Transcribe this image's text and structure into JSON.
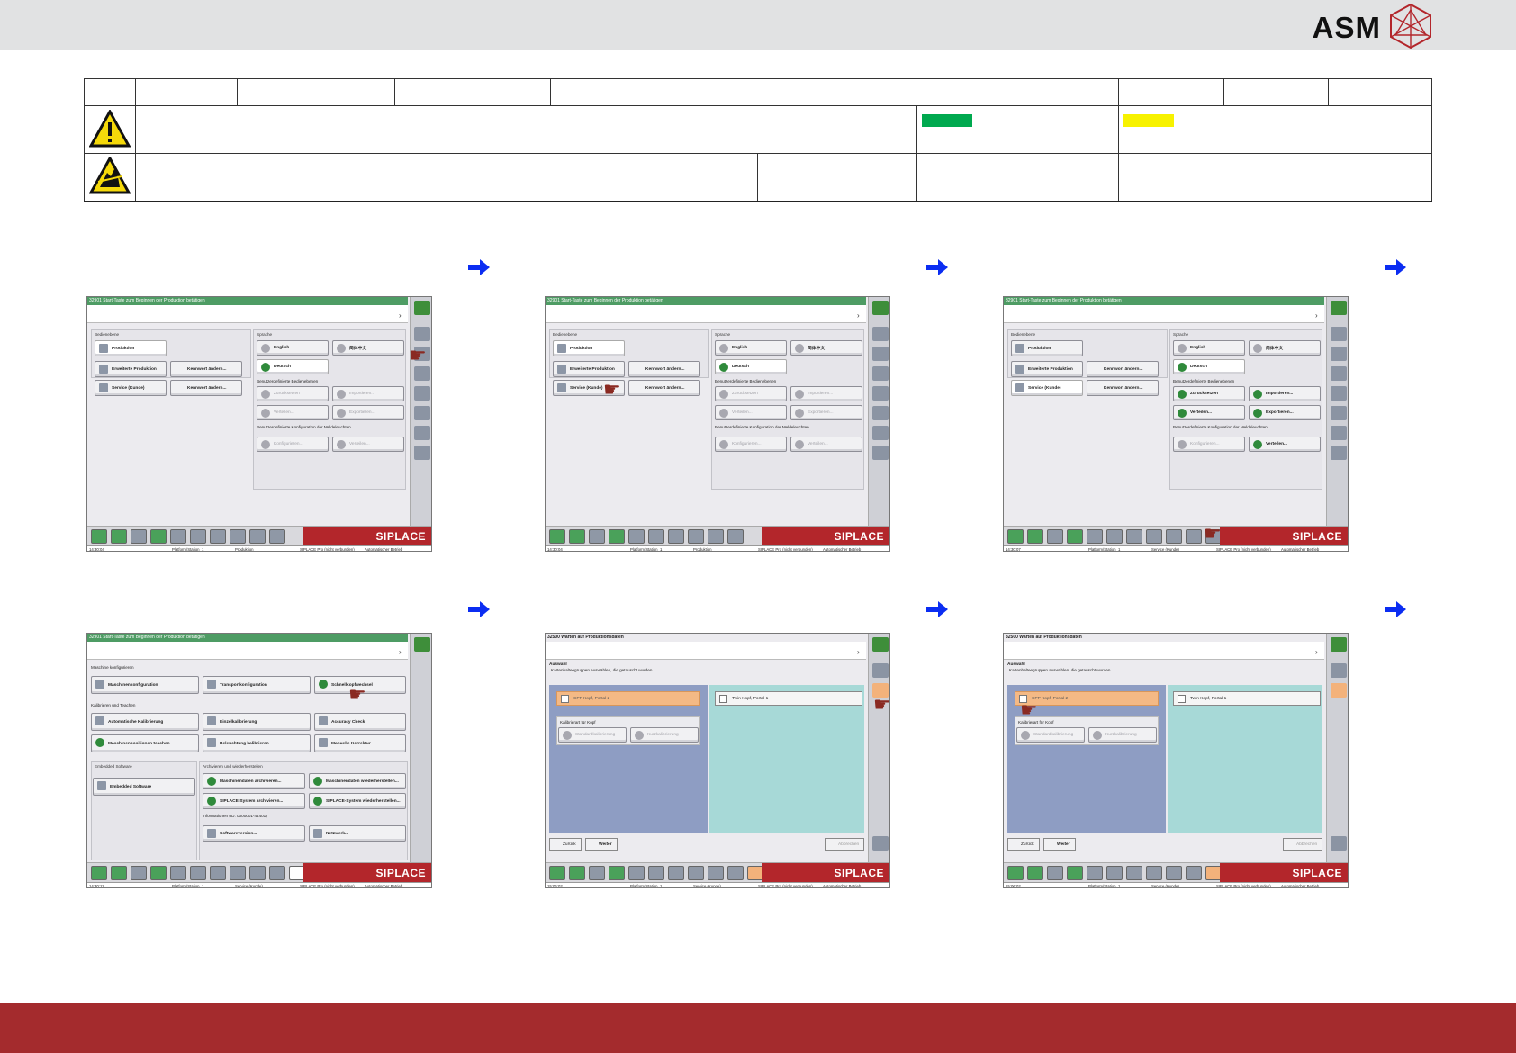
{
  "brand": {
    "name": "ASM"
  },
  "colors": {
    "red": "#a42b2d",
    "green": "#00a94f",
    "yellow": "#f7f200",
    "blue": "#0b2df2",
    "siplace": "#b3262b"
  },
  "icons": {
    "warning": "warning-triangle-icon",
    "esd": "esd-hand-icon",
    "arrow": "right-arrow-icon",
    "hand": "pointing-hand-icon"
  },
  "screens": {
    "common": {
      "title_operation": "32901 Start-Taste zum Beginnen der Produktion betätigen",
      "title_wait": "32500 Warten auf Produktionsdaten",
      "siplace": "SIPLACE",
      "station": "Platform/Station_1",
      "pro_status": "SIPLACE Pro (nicht verbunden)",
      "mode": "Automatischer Betrieb",
      "level_production": "Produktion",
      "level_service": "Service (Kunde)",
      "bedienebene": "Bedienebene",
      "sprache": "Sprache",
      "produktion": "Produktion",
      "erweiterte": "Erweiterte Produktion",
      "service": "Service (Kunde)",
      "kennwort": "Kennwort ändern...",
      "english": "English",
      "chinese": "简体中文",
      "deutsch": "Deutsch",
      "benutzer_ebenen": "Benutzerdefinierte Bedienebenen",
      "zuruecksetzen": "Zurücksetzen",
      "importieren": "Importieren...",
      "verteilen": "Verteilen...",
      "exportieren": "Exportieren...",
      "benutzer_konfig": "Benutzerdefinierte Konfiguration der Meldeleuchten",
      "konfigurieren": "Konfigurieren..."
    },
    "times": {
      "s1": "14:30:04",
      "s2": "14:30:04",
      "s3": "14:30:07",
      "s4": "14:30:11",
      "s5": "15:06:02",
      "s6": "15:06:02"
    },
    "service_menu": {
      "maschine": "Maschine konfigurieren",
      "maschinenkonfiguration": "Maschinenkonfiguration",
      "transportkonfiguration": "Transportkonfiguration",
      "schnellwechsel": "Schnellkopfwechsel",
      "kalibrieren": "Kalibrieren und Teachen",
      "autokal": "Automatische Kalibrierung",
      "einzelkal": "Einzelkalibrierung",
      "accuracy": "Accuracy Check",
      "positionen": "Maschinenpositionen teachen",
      "beleuchtung": "Beleuchtung kalibrieren",
      "manuelle": "Manuelle Korrektur",
      "embedded": "Embedded Software",
      "embedded_btn": "Embedded Software",
      "archivieren": "Archivieren und wiederherstellen",
      "mdaten_arch": "Maschinendaten archivieren...",
      "mdaten_wied": "Maschinendaten wiederherstellen...",
      "sys_arch": "SIPLACE-System archivieren...",
      "sys_wied": "SIPLACE-System wiederherstellen...",
      "info": "Informationen (ID: 0000001-44401)",
      "softwareversion": "Softwareversion...",
      "netzwerk": "Netzwerk..."
    },
    "wizard": {
      "auswahl": "Auswahl",
      "hinweis": "Kartenhalteegruppen auswählen, die getauscht wurden.",
      "cpp": "CPP Kopf, Portal 2",
      "twin": "Twin Kopf, Portal 1",
      "kalibrierart": "Kalibrierart für Kopf",
      "standard": "Standardkalibrierung",
      "kurz": "Kurzkalibrierung",
      "zurueck": "Zurück",
      "weiter": "Weiter",
      "abbrechen": "Abbrechen"
    }
  }
}
